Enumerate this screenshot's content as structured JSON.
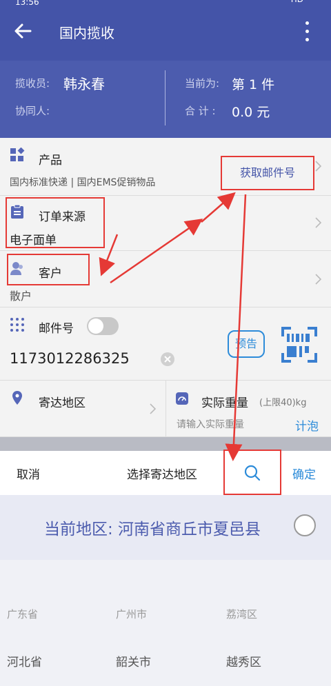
{
  "status": {
    "time": "13:56",
    "network": "HD"
  },
  "header": {
    "title": "国内揽收"
  },
  "summary": {
    "collector_label": "揽收员:",
    "collector_value": "韩永春",
    "assistant_label": "协同人:",
    "current_label": "当前为:",
    "current_value": "第 1 件",
    "total_label": "合 计 :",
    "total_value": "0.0 元"
  },
  "product": {
    "title": "产品",
    "value": "国内标准快递 | 国内EMS促销物品",
    "fetch_label": "获取邮件号"
  },
  "order_source": {
    "title": "订单来源",
    "value": "电子面单"
  },
  "customer": {
    "title": "客户",
    "value": "散户"
  },
  "mail_no": {
    "title": "邮件号",
    "value": "1173012286325",
    "preannounce_label": "预告"
  },
  "destination": {
    "title": "寄达地区"
  },
  "weight": {
    "title": "实际重量",
    "limit": "(上限40)kg",
    "placeholder": "请输入实际重量",
    "calc_label": "计泡"
  },
  "sheet": {
    "cancel": "取消",
    "title": "选择寄达地区",
    "confirm": "确定"
  },
  "current_region": {
    "text": "当前地区: 河南省商丘市夏邑县"
  },
  "picker": {
    "provinces": [
      "广东省",
      "河北省"
    ],
    "cities": [
      "广州市",
      "韶关市"
    ],
    "districts": [
      "荔湾区",
      "越秀区"
    ]
  },
  "colors": {
    "primary": "#4454a8",
    "accent": "#2c8bd9",
    "annotation": "#e53935"
  }
}
